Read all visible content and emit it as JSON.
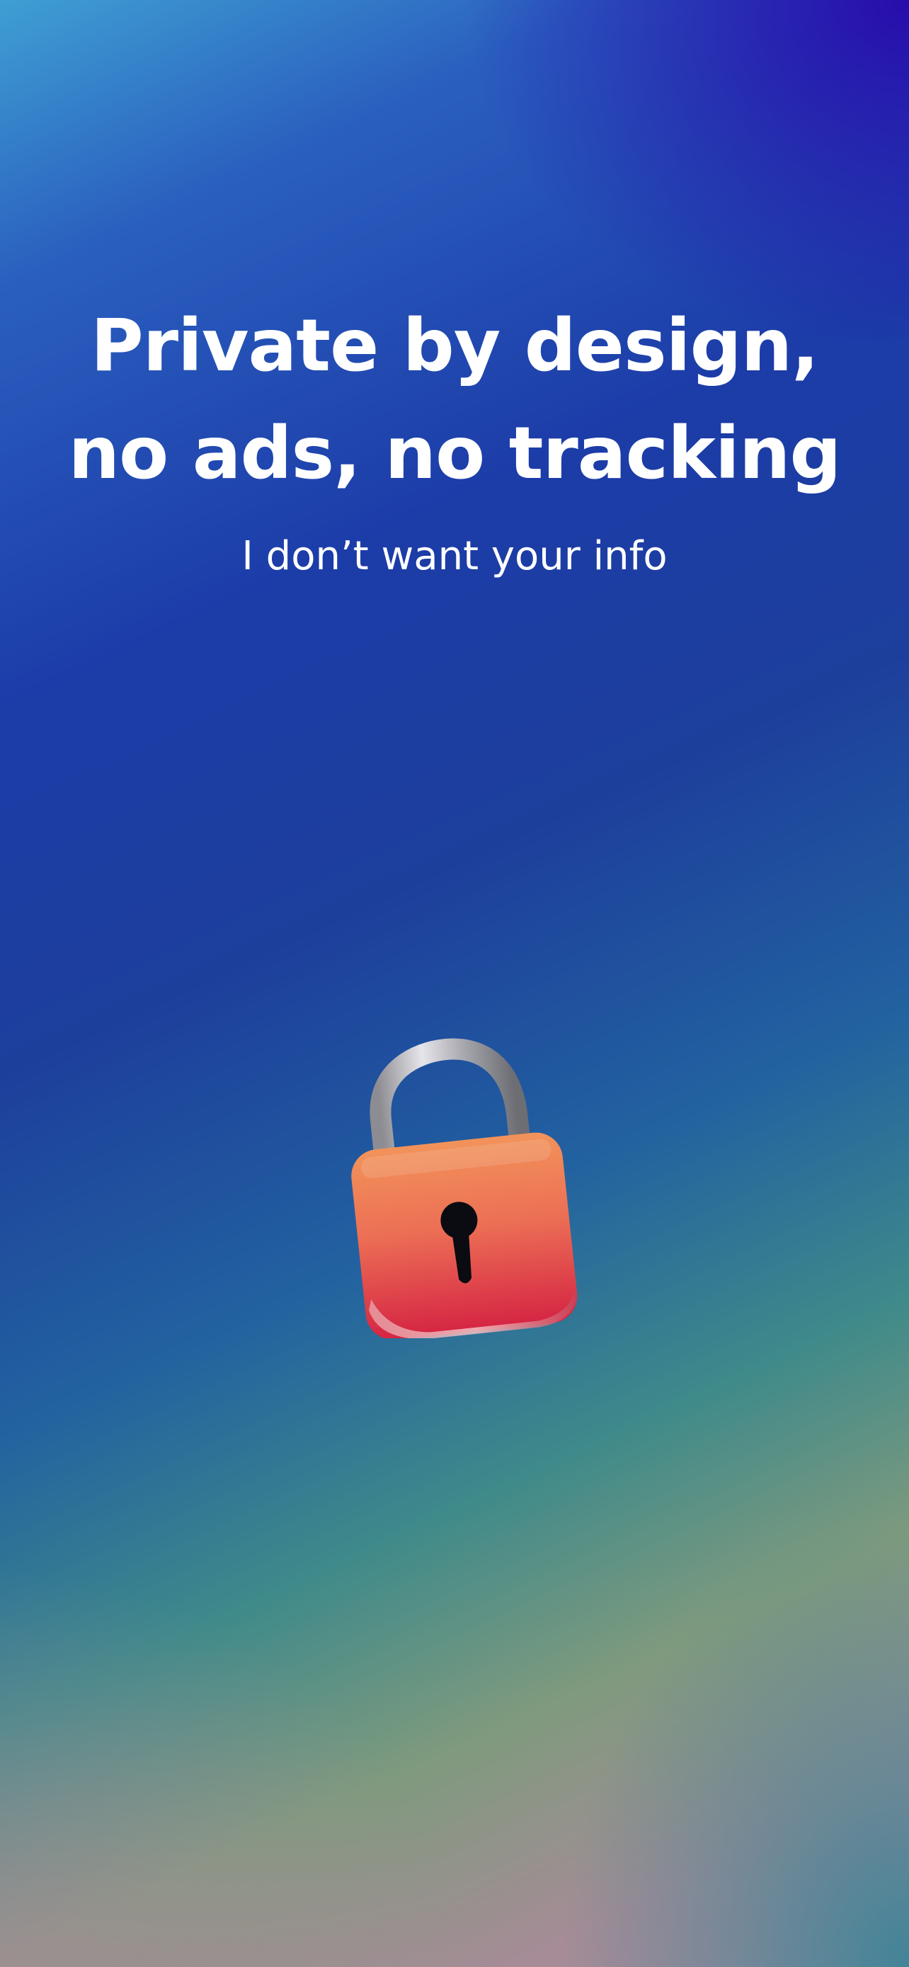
{
  "onboarding": {
    "headline_line1": "Private by design,",
    "headline_line2": "no ads, no tracking",
    "subtitle": "I don’t want your info",
    "illustration_icon": "padlock-icon"
  },
  "colors": {
    "text": "#ffffff",
    "gradient_top_left": "#3f9fd3",
    "gradient_top_right": "#2800aa",
    "gradient_bottom_left": "#ad8a9e",
    "gradient_bottom_right": "#2a8a96",
    "lock_body_top": "#f08a55",
    "lock_body_bottom": "#d82a45",
    "lock_shackle": "#b8b8bc"
  }
}
